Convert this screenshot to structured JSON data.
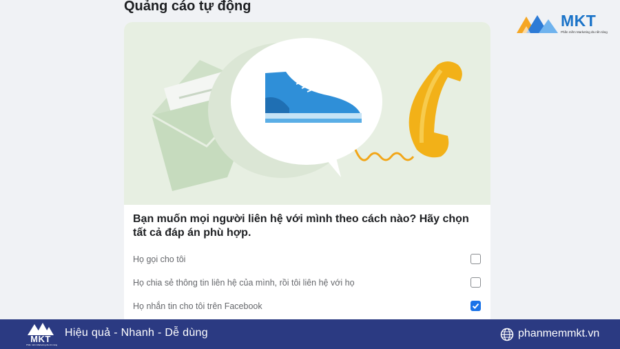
{
  "page": {
    "title": "Quảng cáo tự động"
  },
  "card": {
    "question": "Bạn muốn mọi người liên hệ với mình theo cách nào? Hãy chọn tất cả đáp án phù hợp.",
    "options": [
      {
        "label": "Họ gọi cho tôi",
        "checked": false
      },
      {
        "label": "Họ chia sẻ thông tin liên hệ của mình, rồi tôi liên hệ với họ",
        "checked": false
      },
      {
        "label": "Họ nhắn tin cho tôi trên Facebook",
        "checked": true
      }
    ]
  },
  "brand": {
    "name": "MKT",
    "subtitle": "Phần mềm Marketing đa nền tảng",
    "accent": "#1a73c8"
  },
  "footer": {
    "tagline": "Hiệu quả - Nhanh - Dễ dùng",
    "website": "phanmemmkt.vn",
    "background": "#2b3a82"
  },
  "icons": {
    "illustration": [
      "envelope-icon",
      "shoe-icon",
      "speech-bubble-icon",
      "telephone-icon"
    ],
    "checkbox": "check-icon",
    "website": "globe-icon"
  }
}
